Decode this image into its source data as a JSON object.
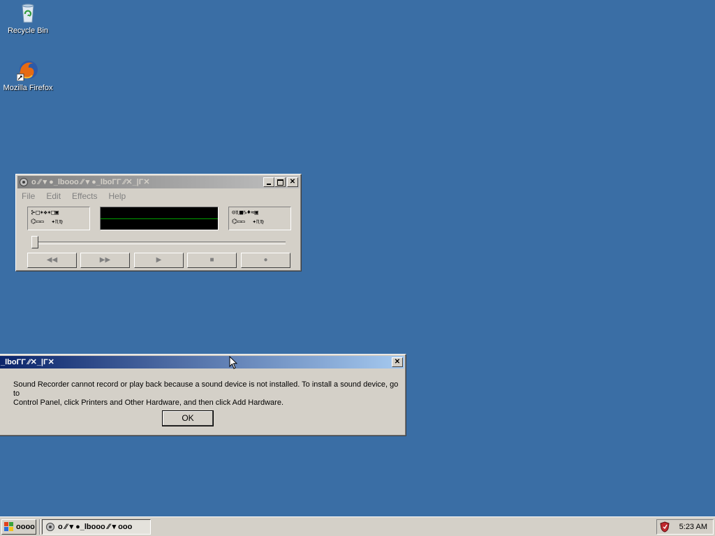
{
  "desktop": {
    "icons": [
      {
        "label": "Recycle Bin",
        "icon": "recycle-bin-icon"
      },
      {
        "label": "Mozilla Firefox",
        "icon": "firefox-icon"
      }
    ],
    "background": "#3a6ea5"
  },
  "sound_recorder": {
    "title": "o ⁄⁄ ▾ ●_lbooo ⁄⁄ ▾ ●_lboΓΓ ⁄⁄✕_|Γ✕",
    "menu": [
      "File",
      "Edit",
      "Effects",
      "Help"
    ],
    "position_readout": "⊱□✶❖✶□▣\n⌬▭▭  ✦♏♍",
    "length_readout": "⊝♏■♑♦≈▣\n⌬▭▭  ✦♏♍",
    "buttons": {
      "rewind": "◀◀",
      "forward": "▶▶",
      "play": "▶",
      "stop": "■",
      "record": "●"
    },
    "slider_value": 0
  },
  "error_dialog": {
    "title": "_lboΓΓ ⁄⁄✕_|Γ✕",
    "message_line1": "Sound Recorder cannot record or play back because a sound device is not installed. To install a sound device, go to",
    "message_line2": "Control Panel, click Printers and Other Hardware, and then click Add Hardware.",
    "ok_label": "OK",
    "close_label": "✕"
  },
  "taskbar": {
    "start_label": "oooo",
    "task_label": "o ⁄⁄ ▾ ●_lbooo ⁄⁄ ▾ ooo",
    "clock": "5:23 AM",
    "tray_icon": "shield-icon"
  },
  "colors": {
    "face": "#d4d0c8",
    "active_title_start": "#0a246a",
    "active_title_end": "#a6caf0",
    "inactive_title_start": "#808080",
    "inactive_title_end": "#c0c0c0"
  }
}
